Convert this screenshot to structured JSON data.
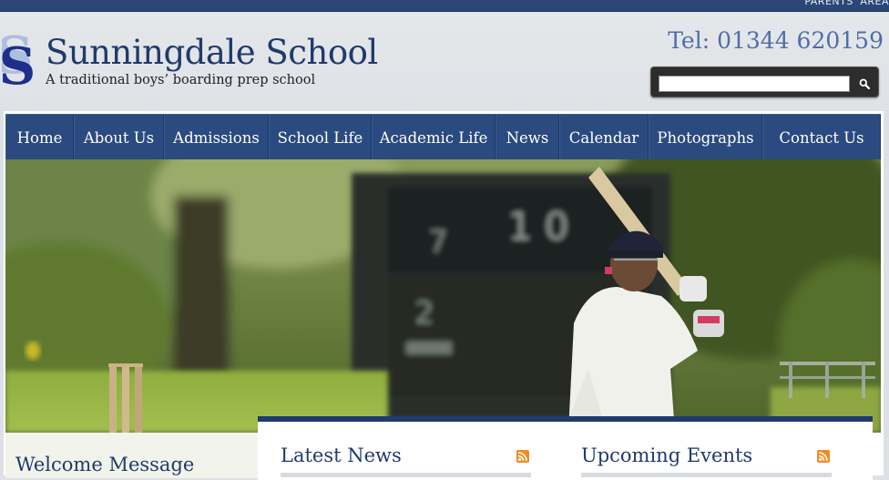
{
  "topbar": {
    "parents_area": "PARENTS' AREA"
  },
  "header": {
    "logo_letter": "S",
    "school_name": "Sunningdale School",
    "tagline": "A traditional boys’ boarding prep school",
    "phone": "Tel: 01344 620159"
  },
  "search": {
    "value": "",
    "placeholder": ""
  },
  "nav": {
    "items": [
      {
        "label": "Home"
      },
      {
        "label": "About Us"
      },
      {
        "label": "Admissions"
      },
      {
        "label": "School Life"
      },
      {
        "label": "Academic Life"
      },
      {
        "label": "News"
      },
      {
        "label": "Calendar"
      },
      {
        "label": "Photographs"
      },
      {
        "label": "Contact Us"
      }
    ]
  },
  "sections": {
    "welcome_title": "Welcome Message",
    "latest_news_title": "Latest News",
    "upcoming_events_title": "Upcoming Events"
  },
  "colors": {
    "brand_navy": "#2b4a7f",
    "accent_blue": "#4f6da8",
    "rss_orange": "#f08c22"
  }
}
